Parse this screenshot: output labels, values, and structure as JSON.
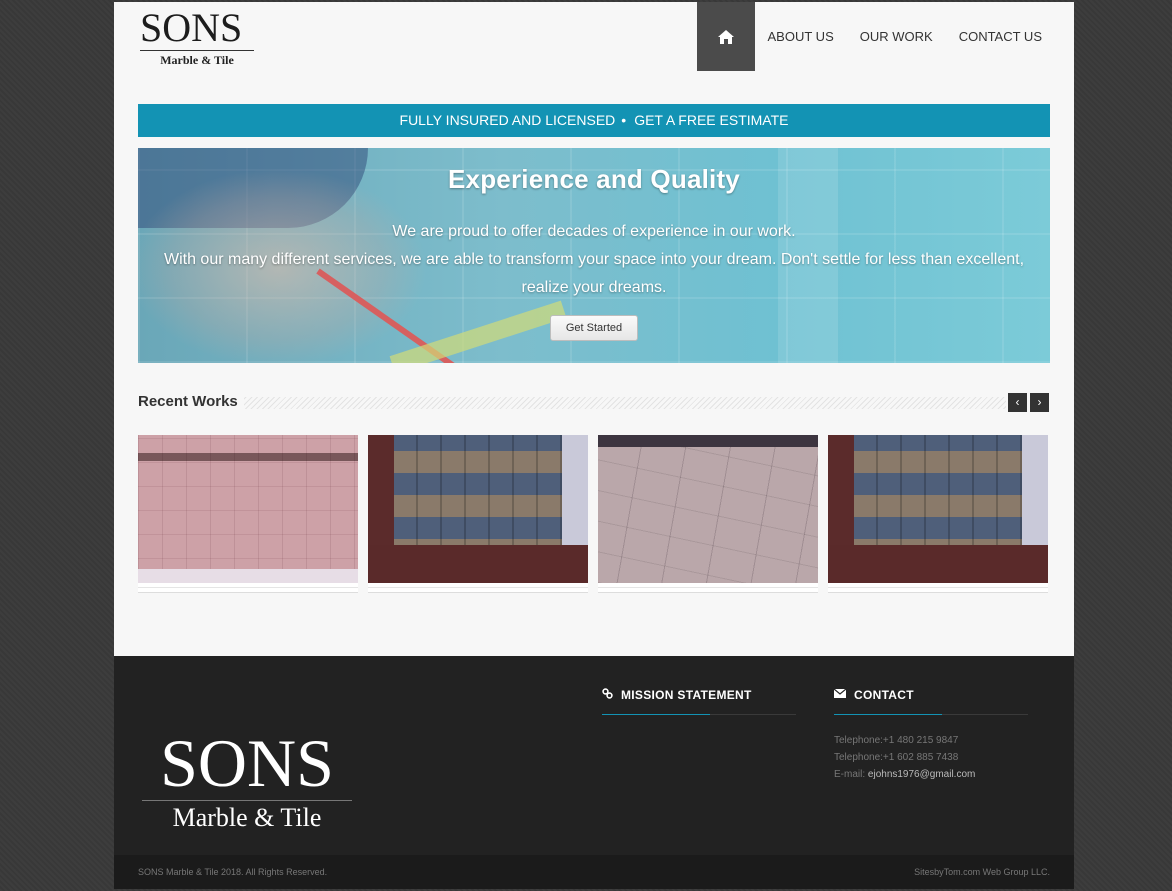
{
  "brand": {
    "logo_main": "SONS",
    "logo_sub": "Marble & Tile"
  },
  "nav": {
    "home_icon": "home-icon",
    "items": [
      "ABOUT US",
      "OUR WORK",
      "CONTACT US"
    ]
  },
  "strip": {
    "left": "FULLY INSURED AND LICENSED",
    "separator": "•",
    "right": "GET A FREE ESTIMATE"
  },
  "hero": {
    "title": "Experience and Quality",
    "line1": "We are proud to offer decades of experience in our work.",
    "line2": "With our many different services, we are able to transform your space into your dream. Don't settle for less than excellent,",
    "line3": "realize your dreams.",
    "button": "Get Started"
  },
  "recent_works": {
    "title": "Recent Works",
    "prev": "‹",
    "next": "›"
  },
  "footer": {
    "logo_main": "SONS",
    "logo_sub": "Marble & Tile",
    "mission_title": "MISSION STATEMENT",
    "contact_title": "CONTACT",
    "telephone1": "Telephone:+1 480 215 9847",
    "telephone2": "Telephone:+1 602 885 7438",
    "email_label": "E-mail: ",
    "email": "ejohns1976@gmail.com",
    "copyright": "SONS Marble & Tile 2018. All Rights Reserved.",
    "credit": "SitesbyTom.com Web Group LLC."
  },
  "colors": {
    "accent": "#1393b4",
    "footer_bg": "#222222",
    "nav_active": "#4b4b4b"
  }
}
